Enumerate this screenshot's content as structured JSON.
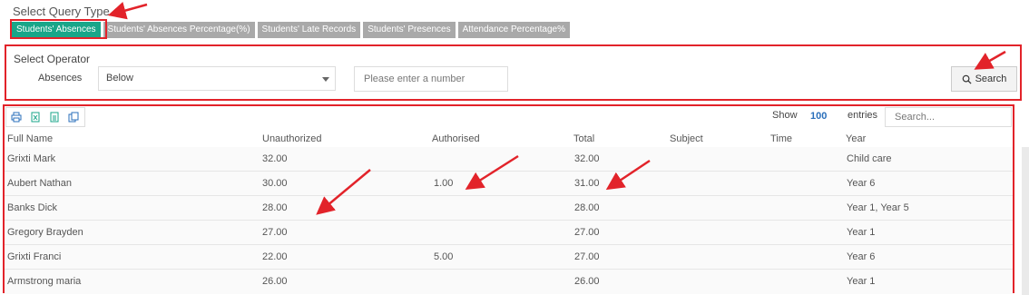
{
  "query": {
    "label": "Select Query Type",
    "tabs": [
      {
        "label": "Students' Absences",
        "active": true
      },
      {
        "label": "Students' Absences Percentage(%)",
        "active": false
      },
      {
        "label": "Students' Late Records",
        "active": false
      },
      {
        "label": "Students' Presences",
        "active": false
      },
      {
        "label": "Attendance Percentage%",
        "active": false
      }
    ]
  },
  "operator": {
    "label": "Select Operator",
    "field_label": "Absences",
    "selected": "Below",
    "number_placeholder": "Please enter a number",
    "search_label": "Search"
  },
  "table": {
    "show_label": "Show",
    "show_count": "100",
    "entries_label": "entries",
    "search_placeholder": "Search...",
    "columns": [
      "Full Name",
      "Unauthorized",
      "Authorised",
      "Total",
      "Subject",
      "Time",
      "Year"
    ],
    "rows": [
      {
        "name": "Grixti Mark",
        "unauthorized": "32.00",
        "authorised": "",
        "total": "32.00",
        "subject": "",
        "time": "",
        "year": "Child care"
      },
      {
        "name": "Aubert Nathan",
        "unauthorized": "30.00",
        "authorised": "1.00",
        "total": "31.00",
        "subject": "",
        "time": "",
        "year": "Year 6"
      },
      {
        "name": "Banks Dick",
        "unauthorized": "28.00",
        "authorised": "",
        "total": "28.00",
        "subject": "",
        "time": "",
        "year": "Year 1, Year 5"
      },
      {
        "name": "Gregory Brayden",
        "unauthorized": "27.00",
        "authorised": "",
        "total": "27.00",
        "subject": "",
        "time": "",
        "year": "Year 1"
      },
      {
        "name": "Grixti Franci",
        "unauthorized": "22.00",
        "authorised": "5.00",
        "total": "27.00",
        "subject": "",
        "time": "",
        "year": "Year 6"
      },
      {
        "name": "Armstrong maria",
        "unauthorized": "26.00",
        "authorised": "",
        "total": "26.00",
        "subject": "",
        "time": "",
        "year": "Year 1"
      }
    ]
  },
  "colors": {
    "accent": "#18a689",
    "inactive_tab": "#a9a9a9",
    "highlight": "#e2232a",
    "link": "#2a6fbb"
  },
  "icons": [
    "print-icon",
    "excel-icon",
    "csv-icon",
    "copy-icon",
    "search-icon",
    "chevron-down-icon"
  ]
}
